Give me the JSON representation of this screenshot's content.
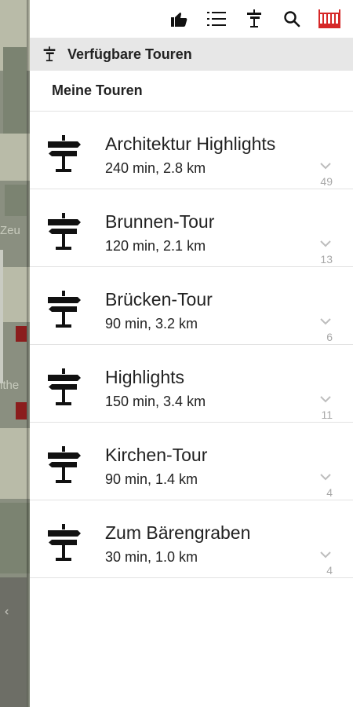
{
  "toolbar": {
    "icons": [
      "thumbs-up-icon",
      "list-icon",
      "signpost-icon",
      "search-icon",
      "city-skyline-icon"
    ]
  },
  "available_tours": {
    "title": "Verfügbare Touren"
  },
  "section": {
    "title": "Meine Touren"
  },
  "tours": [
    {
      "name": "Architektur Highlights",
      "meta": "240 min, 2.8 km",
      "count": "49"
    },
    {
      "name": "Brunnen-Tour",
      "meta": "120 min, 2.1 km",
      "count": "13"
    },
    {
      "name": "Brücken-Tour",
      "meta": "90 min, 3.2 km",
      "count": "6"
    },
    {
      "name": "Highlights",
      "meta": "150 min, 3.4 km",
      "count": "11"
    },
    {
      "name": "Kirchen-Tour",
      "meta": "90 min, 1.4 km",
      "count": "4"
    },
    {
      "name": "Zum Bärengraben",
      "meta": "30 min, 1.0 km",
      "count": "4"
    }
  ],
  "map": {
    "labels": [
      "Zeu",
      "ithe"
    ]
  },
  "colors": {
    "header_bg": "#e7e7e7",
    "accent_red": "#d62828",
    "count_gray": "#a8a8a8"
  }
}
